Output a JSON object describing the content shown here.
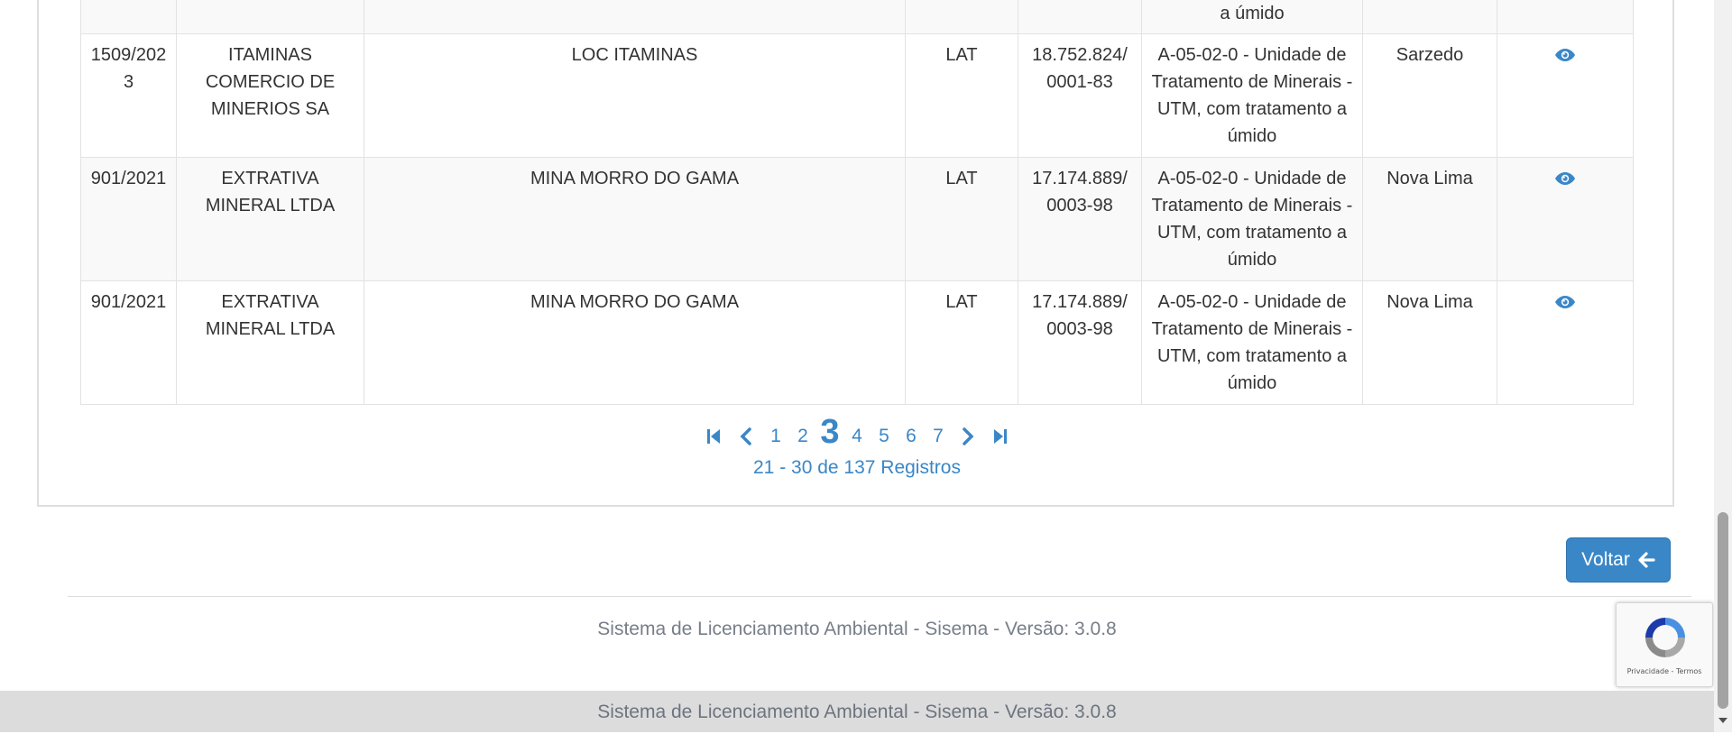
{
  "table": {
    "rows": [
      {
        "processo": "",
        "empreendedor": "",
        "empreendimento": "",
        "modalidade": "",
        "cnpj": "",
        "atividade": "a úmido",
        "municipio": ""
      },
      {
        "processo": "1509/2023",
        "empreendedor": "ITAMINAS COMERCIO DE MINERIOS SA",
        "empreendimento": "LOC ITAMINAS",
        "modalidade": "LAT",
        "cnpj": "18.752.824/ 0001-83",
        "atividade": "A-05-02-0 - Unidade de Tratamento de Minerais - UTM, com tratamento a úmido",
        "municipio": "Sarzedo"
      },
      {
        "processo": "901/2021",
        "empreendedor": "EXTRATIVA MINERAL LTDA",
        "empreendimento": "MINA MORRO DO GAMA",
        "modalidade": "LAT",
        "cnpj": "17.174.889/ 0003-98",
        "atividade": "A-05-02-0 - Unidade de Tratamento de Minerais - UTM, com tratamento a úmido",
        "municipio": "Nova Lima"
      },
      {
        "processo": "901/2021",
        "empreendedor": "EXTRATIVA MINERAL LTDA",
        "empreendimento": "MINA MORRO DO GAMA",
        "modalidade": "LAT",
        "cnpj": "17.174.889/ 0003-98",
        "atividade": "A-05-02-0 - Unidade de Tratamento de Minerais - UTM, com tratamento a úmido",
        "municipio": "Nova Lima"
      }
    ],
    "row_action_icon": "eye-icon"
  },
  "pagination": {
    "pages": [
      "1",
      "2",
      "3",
      "4",
      "5",
      "6",
      "7"
    ],
    "current": "3",
    "info": "21 - 30 de 137 Registros",
    "icons": [
      "first-page-icon",
      "prev-page-icon",
      "next-page-icon",
      "last-page-icon"
    ]
  },
  "actions": {
    "voltar_label": "Voltar",
    "voltar_icon": "arrow-left-icon"
  },
  "footer": {
    "text": "Sistema de Licenciamento Ambiental - Sisema - Versão: 3.0.8",
    "bar_text": "Sistema de Licenciamento Ambiental - Sisema - Versão: 3.0.8"
  },
  "recaptcha": {
    "links": "Privacidade - Termos"
  },
  "colors": {
    "accent": "#3a87c8",
    "row_alt": "#f9f9f9",
    "footer_bar": "#dcdcdc"
  }
}
